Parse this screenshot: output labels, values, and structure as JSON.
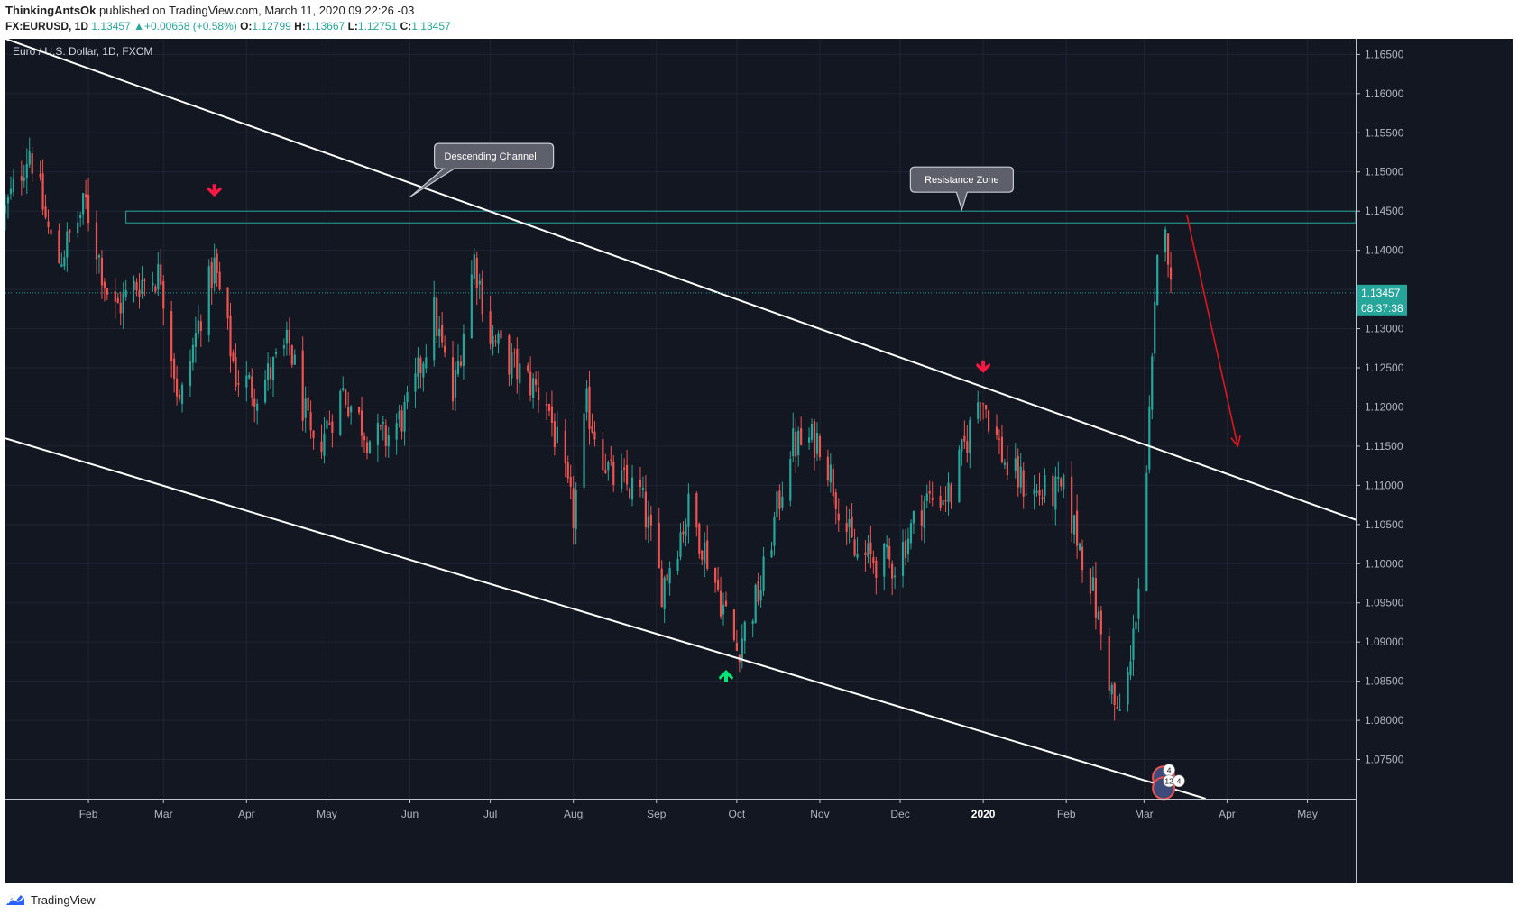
{
  "header": {
    "author": "ThinkingAntsOk",
    "published_text": " published on TradingView.com, March 11, 2020 09:22:26 -03",
    "symbol": "FX:EURUSD, 1D",
    "last": "1.13457",
    "change_arrow": "▲",
    "change": "+0.00658 (+0.58%)",
    "open_label": "O:",
    "open": "1.12799",
    "high_label": "H:",
    "high": "1.13667",
    "low_label": "L:",
    "low": "1.12751",
    "close_label": "C:",
    "close": "1.13457"
  },
  "footer": {
    "brand": "TradingView"
  },
  "colors": {
    "background": "#131722",
    "up": "#26a69a",
    "down": "#ef5350",
    "grid": "#1f2433",
    "axis_text": "#b2b5be",
    "trendline": "#ffffff",
    "zone": "#26a69a",
    "callout_bg": "#5d606b",
    "red_arrow": "#ff1744",
    "green_arrow": "#00e676",
    "price_tag": "#26a69a"
  },
  "chart_data": {
    "type": "candlestick",
    "title": "Euro / U.S. Dollar, 1D, FXCM",
    "y_axis": {
      "range": [
        1.07,
        1.167
      ],
      "ticks": [
        "1.16500",
        "1.16000",
        "1.15500",
        "1.15000",
        "1.14500",
        "1.14000",
        "1.13500",
        "1.13000",
        "1.12500",
        "1.12000",
        "1.11500",
        "1.11000",
        "1.10500",
        "1.10000",
        "1.09500",
        "1.09000",
        "1.08500",
        "1.08000",
        "1.07500"
      ],
      "tick_values": [
        1.165,
        1.16,
        1.155,
        1.15,
        1.145,
        1.14,
        1.135,
        1.13,
        1.125,
        1.12,
        1.115,
        1.11,
        1.105,
        1.1,
        1.095,
        1.09,
        1.085,
        1.08,
        1.075
      ]
    },
    "x_axis": {
      "range": [
        "2019-01-01",
        "2020-05-19"
      ],
      "ticks": [
        {
          "date": "2019-02-01",
          "label": "Feb",
          "bold": false
        },
        {
          "date": "2019-03-01",
          "label": "Mar",
          "bold": false
        },
        {
          "date": "2019-04-01",
          "label": "Apr",
          "bold": false
        },
        {
          "date": "2019-05-01",
          "label": "May",
          "bold": false
        },
        {
          "date": "2019-06-01",
          "label": "Jun",
          "bold": false
        },
        {
          "date": "2019-07-01",
          "label": "Jul",
          "bold": false
        },
        {
          "date": "2019-08-01",
          "label": "Aug",
          "bold": false
        },
        {
          "date": "2019-09-01",
          "label": "Sep",
          "bold": false
        },
        {
          "date": "2019-10-01",
          "label": "Oct",
          "bold": false
        },
        {
          "date": "2019-11-01",
          "label": "Nov",
          "bold": false
        },
        {
          "date": "2019-12-01",
          "label": "Dec",
          "bold": false
        },
        {
          "date": "2020-01-01",
          "label": "2020",
          "bold": true
        },
        {
          "date": "2020-02-01",
          "label": "Feb",
          "bold": false
        },
        {
          "date": "2020-03-01",
          "label": "Mar",
          "bold": false
        },
        {
          "date": "2020-04-01",
          "label": "Apr",
          "bold": false
        },
        {
          "date": "2020-05-01",
          "label": "May",
          "bold": false
        }
      ]
    },
    "price_path": [
      [
        "2019-01-01",
        1.145
      ],
      [
        "2019-01-10",
        1.153
      ],
      [
        "2019-01-20",
        1.138
      ],
      [
        "2019-01-31",
        1.146
      ],
      [
        "2019-02-10",
        1.132
      ],
      [
        "2019-02-20",
        1.136
      ],
      [
        "2019-02-28",
        1.137
      ],
      [
        "2019-03-07",
        1.12
      ],
      [
        "2019-03-15",
        1.132
      ],
      [
        "2019-03-20",
        1.138
      ],
      [
        "2019-03-28",
        1.124
      ],
      [
        "2019-04-05",
        1.122
      ],
      [
        "2019-04-17",
        1.128
      ],
      [
        "2019-04-26",
        1.114
      ],
      [
        "2019-05-07",
        1.122
      ],
      [
        "2019-05-17",
        1.116
      ],
      [
        "2019-05-23",
        1.116
      ],
      [
        "2019-06-01",
        1.12
      ],
      [
        "2019-06-10",
        1.132
      ],
      [
        "2019-06-17",
        1.121
      ],
      [
        "2019-06-25",
        1.139
      ],
      [
        "2019-07-01",
        1.129
      ],
      [
        "2019-07-10",
        1.125
      ],
      [
        "2019-07-22",
        1.121
      ],
      [
        "2019-08-01",
        1.106
      ],
      [
        "2019-08-06",
        1.12
      ],
      [
        "2019-08-15",
        1.111
      ],
      [
        "2019-08-26",
        1.109
      ],
      [
        "2019-09-03",
        1.097
      ],
      [
        "2019-09-13",
        1.107
      ],
      [
        "2019-09-20",
        1.101
      ],
      [
        "2019-10-01",
        1.089
      ],
      [
        "2019-10-10",
        1.097
      ],
      [
        "2019-10-21",
        1.115
      ],
      [
        "2019-11-01",
        1.116
      ],
      [
        "2019-11-14",
        1.101
      ],
      [
        "2019-11-29",
        1.1
      ],
      [
        "2019-12-10",
        1.108
      ],
      [
        "2019-12-20",
        1.109
      ],
      [
        "2019-12-31",
        1.122
      ],
      [
        "2020-01-10",
        1.112
      ],
      [
        "2020-01-20",
        1.109
      ],
      [
        "2020-01-31",
        1.109
      ],
      [
        "2020-02-10",
        1.098
      ],
      [
        "2020-02-20",
        1.08
      ],
      [
        "2020-02-25",
        1.087
      ],
      [
        "2020-03-01",
        1.105
      ],
      [
        "2020-03-06",
        1.138
      ],
      [
        "2020-03-09",
        1.145
      ],
      [
        "2020-03-11",
        1.1346
      ]
    ],
    "lines": [
      {
        "from": [
          "2019-01-01",
          1.167
        ],
        "to": [
          "2020-05-24",
          1.105
        ]
      },
      {
        "from": [
          "2019-01-01",
          1.116
        ],
        "to": [
          "2020-03-24",
          1.07
        ]
      }
    ],
    "resistance_zone": {
      "from": "2019-02-15",
      "price_top": 1.145,
      "price_bottom": 1.1435
    },
    "last_price_line": 1.13457,
    "price_tag": {
      "price": "1.13457",
      "countdown": "08:37:38"
    },
    "annotations": [
      {
        "text": "Descending Channel",
        "at": [
          "2019-07-01",
          1.1518
        ]
      },
      {
        "text": "Resistance Zone",
        "at": [
          "2019-12-24",
          1.1488
        ]
      }
    ],
    "signal_arrows": [
      {
        "dir": "down",
        "at": [
          "2019-03-20",
          1.1473
        ]
      },
      {
        "dir": "down",
        "at": [
          "2020-01-01",
          1.1248
        ]
      },
      {
        "dir": "up",
        "at": [
          "2019-09-27",
          1.086
        ]
      }
    ],
    "forecast_arrow": {
      "from": [
        "2020-03-17",
        1.1445
      ],
      "to": [
        "2020-04-05",
        1.115
      ]
    },
    "event_badges": [
      {
        "count": "4",
        "at": [
          "2020-03-09",
          1.0732
        ]
      },
      {
        "count": "12",
        "at": [
          "2020-03-09",
          1.0718
        ]
      },
      {
        "count": "4",
        "at": [
          "2020-03-14",
          1.0718
        ]
      }
    ]
  }
}
